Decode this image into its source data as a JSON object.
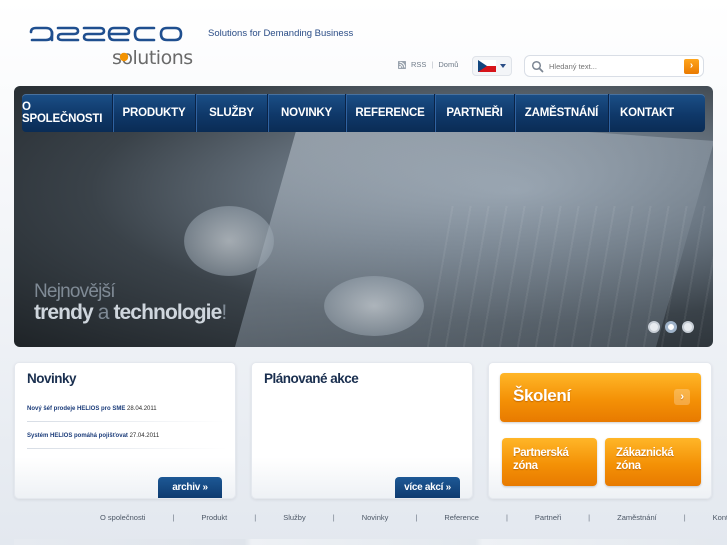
{
  "header": {
    "logo_main": "asseco",
    "logo_sub": "solutions",
    "tagline": "Solutions for Demanding Business",
    "util_links": {
      "rss": "RSS",
      "home": "Domů",
      "separator": "|"
    },
    "language": {
      "selected_icon": "czech-flag-icon"
    },
    "search": {
      "placeholder": "Hledaný text...",
      "submit_icon": "arrow-right-icon"
    }
  },
  "nav": {
    "items": [
      "O SPOLEČNOSTI",
      "PRODUKTY",
      "SLUŽBY",
      "NOVINKY",
      "REFERENCE",
      "PARTNEŘI",
      "ZAMĚSTNÁNÍ",
      "KONTAKT"
    ]
  },
  "hero": {
    "slogan_line1": "Nejnovější",
    "slogan_word1": "trendy",
    "slogan_conj": "a",
    "slogan_word2": "technologie",
    "slogan_end": "!",
    "slides": {
      "count": 3,
      "active_index": 1
    }
  },
  "news": {
    "title": "Novinky",
    "items": [
      {
        "text": "Nový šéf prodeje HELIOS pro SME",
        "date": "28.04.2011"
      },
      {
        "text": "Systém HELIOS pomáhá pojišťovat",
        "date": "27.04.2011"
      }
    ],
    "button": "archiv »"
  },
  "events": {
    "title": "Plánované akce",
    "button": "více akcí »"
  },
  "side": {
    "training": "Školení",
    "training_icon": "chevron-right-icon",
    "partner_zone": {
      "line1": "Partnerská",
      "line2": "zóna"
    },
    "customer_zone": {
      "line1": "Zákaznická",
      "line2": "zóna"
    }
  },
  "footer": {
    "links": [
      "O společnosti",
      "Produkt",
      "Služby",
      "Novinky",
      "Reference",
      "Partneři",
      "Zaměstnání",
      "Kontakt"
    ],
    "separator": "|"
  },
  "colors": {
    "nav_blue": "#0f3869",
    "accent_orange": "#f49106",
    "text_blue": "#1b3c7a"
  }
}
